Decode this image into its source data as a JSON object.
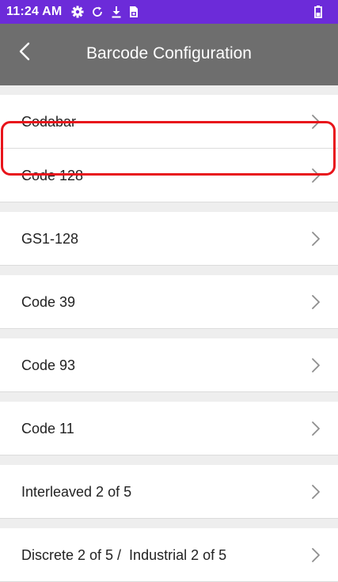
{
  "status_bar": {
    "time": "11:24 AM",
    "icons": [
      "gear-icon",
      "sync-icon",
      "download-icon",
      "sim-icon"
    ],
    "battery_icon": "battery-icon",
    "background": "#6c2bd9"
  },
  "app_bar": {
    "title": "Barcode Configuration",
    "back_icon": "chevron-left-icon",
    "background": "#6e6e6e"
  },
  "list": {
    "items": [
      {
        "label": "Codabar"
      },
      {
        "label": "Code 128",
        "highlighted": true
      },
      {
        "label": "GS1-128"
      },
      {
        "label": "Code 39"
      },
      {
        "label": "Code 93"
      },
      {
        "label": "Code 11"
      },
      {
        "label": "Interleaved 2 of 5"
      },
      {
        "label": "Discrete 2 of 5 /  Industrial 2 of 5"
      }
    ],
    "chevron_icon": "chevron-right-icon",
    "highlight_color": "#e8141b"
  }
}
